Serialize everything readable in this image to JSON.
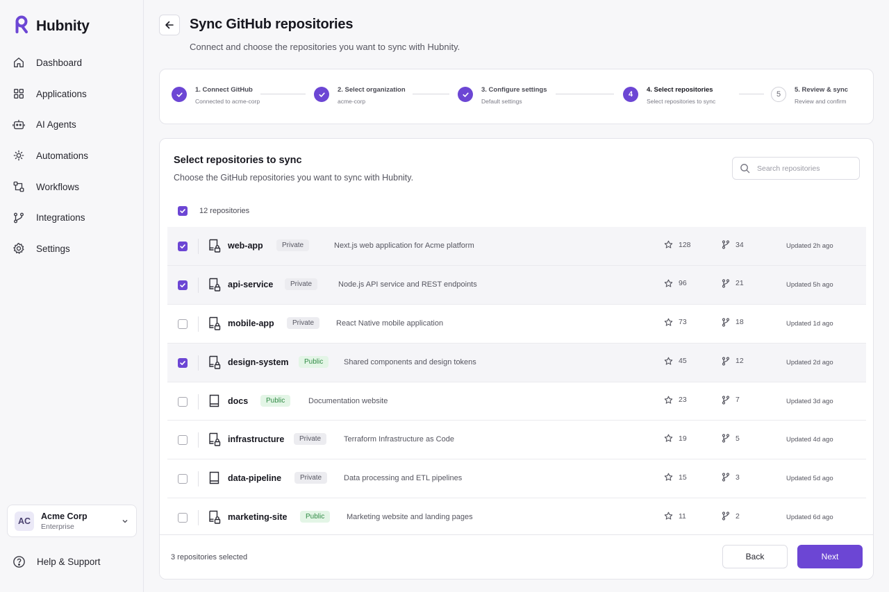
{
  "app": {
    "name": "Hubnity",
    "accent": "#6c46d4"
  },
  "sidebar": {
    "items": [
      {
        "label": "Dashboard",
        "icon": "home-icon"
      },
      {
        "label": "Applications",
        "icon": "grid-icon"
      },
      {
        "label": "AI Agents",
        "icon": "bot-icon"
      },
      {
        "label": "Automations",
        "icon": "automation-icon"
      },
      {
        "label": "Workflows",
        "icon": "workflow-icon"
      },
      {
        "label": "Integrations",
        "icon": "integrations-icon"
      },
      {
        "label": "Settings",
        "icon": "gear-icon"
      }
    ],
    "org": {
      "initials": "AC",
      "name": "Acme Corp",
      "plan": "Enterprise"
    },
    "help": "Help & Support"
  },
  "header": {
    "title": "Sync GitHub repositories",
    "subtitle": "Connect and choose the repositories you want to sync with Hubnity."
  },
  "steps": [
    {
      "title": "1. Connect GitHub",
      "desc": "Connected to acme-corp",
      "state": "done"
    },
    {
      "title": "2. Select organization",
      "desc": "acme-corp",
      "state": "done"
    },
    {
      "title": "3. Configure settings",
      "desc": "Default settings",
      "state": "done"
    },
    {
      "title": "4. Select repositories",
      "desc": "Select repositories to sync",
      "state": "active",
      "num": "4"
    },
    {
      "title": "5. Review & sync",
      "desc": "Review and confirm",
      "state": "pending",
      "num": "5"
    }
  ],
  "panel": {
    "title": "Select repositories to sync",
    "subtitle": "Choose the GitHub repositories you want to sync with Hubnity.",
    "search_placeholder": "Search repositories",
    "select_all_label": "12 repositories"
  },
  "repos": [
    {
      "name": "web-app",
      "visibility": "Private",
      "desc": "Next.js web application for Acme platform",
      "stars": "128",
      "forks": "34",
      "updated": "Updated 2h ago",
      "checked": true
    },
    {
      "name": "api-service",
      "visibility": "Private",
      "desc": "Node.js API service and REST endpoints",
      "stars": "96",
      "forks": "21",
      "updated": "Updated 5h ago",
      "checked": true
    },
    {
      "name": "mobile-app",
      "visibility": "Private",
      "desc": "React Native mobile application",
      "stars": "73",
      "forks": "18",
      "updated": "Updated 1d ago",
      "checked": false
    },
    {
      "name": "design-system",
      "visibility": "Public",
      "desc": "Shared components and design tokens",
      "stars": "45",
      "forks": "12",
      "updated": "Updated 2d ago",
      "checked": true
    },
    {
      "name": "docs",
      "visibility": "Public",
      "desc": "Documentation website",
      "stars": "23",
      "forks": "7",
      "updated": "Updated 3d ago",
      "checked": false
    },
    {
      "name": "infrastructure",
      "visibility": "Private",
      "desc": "Terraform Infrastructure as Code",
      "stars": "19",
      "forks": "5",
      "updated": "Updated 4d ago",
      "checked": false
    },
    {
      "name": "data-pipeline",
      "visibility": "Private",
      "desc": "Data processing and ETL pipelines",
      "stars": "15",
      "forks": "3",
      "updated": "Updated 5d ago",
      "checked": false
    },
    {
      "name": "marketing-site",
      "visibility": "Public",
      "desc": "Marketing website and landing pages",
      "stars": "11",
      "forks": "2",
      "updated": "Updated 6d ago",
      "checked": false
    }
  ],
  "footer": {
    "selected_count": "3 repositories selected",
    "back_label": "Back",
    "next_label": "Next"
  }
}
